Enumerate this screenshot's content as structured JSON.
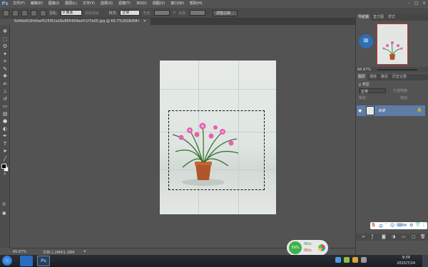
{
  "app": {
    "logo": "Ps",
    "menus": [
      "文件(F)",
      "编辑(E)",
      "图像(I)",
      "图层(L)",
      "文字(Y)",
      "选择(S)",
      "滤镜(T)",
      "3D(D)",
      "视图(V)",
      "窗口(W)",
      "帮助(H)"
    ],
    "window_controls": [
      "–",
      "□",
      "×"
    ]
  },
  "options_bar": {
    "feather_label": "羽化:",
    "feather_value": "0 像素",
    "antialias_label": "消除锯齿",
    "style_label": "样式:",
    "style_value": "正常",
    "width_label": "宽度:",
    "height_label": "高度:",
    "refine_button": "调整边缘..."
  },
  "document": {
    "tab_title": "6d4bb616fdfaef515f61a16e895494eef11f7a05.jpg @ 66.7%(RGB/8#)",
    "tab_close": "×"
  },
  "tools": [
    {
      "icon": "move-tool",
      "glyph": "✥"
    },
    {
      "icon": "marquee-tool",
      "glyph": "⬚"
    },
    {
      "icon": "lasso-tool",
      "glyph": "ʘ"
    },
    {
      "icon": "magic-wand-tool",
      "glyph": "✦"
    },
    {
      "icon": "crop-tool",
      "glyph": "⌗"
    },
    {
      "icon": "eyedropper-tool",
      "glyph": "✎"
    },
    {
      "icon": "healing-brush-tool",
      "glyph": "✚"
    },
    {
      "icon": "brush-tool",
      "glyph": "✍"
    },
    {
      "icon": "clone-stamp-tool",
      "glyph": "⊥"
    },
    {
      "icon": "history-brush-tool",
      "glyph": "↺"
    },
    {
      "icon": "eraser-tool",
      "glyph": "▭"
    },
    {
      "icon": "gradient-tool",
      "glyph": "▤"
    },
    {
      "icon": "blur-tool",
      "glyph": "●"
    },
    {
      "icon": "dodge-tool",
      "glyph": "◐"
    },
    {
      "icon": "pen-tool",
      "glyph": "✒"
    },
    {
      "icon": "type-tool",
      "glyph": "T"
    },
    {
      "icon": "path-selection-tool",
      "glyph": "➤"
    },
    {
      "icon": "shape-tool",
      "glyph": "╱"
    },
    {
      "icon": "hand-tool",
      "glyph": "✋"
    },
    {
      "icon": "zoom-tool",
      "glyph": "⌕"
    }
  ],
  "status_bar": {
    "zoom": "66.67%",
    "doc_info": "文档:1.28M/1.28M"
  },
  "float_widget": {
    "percent": "59%",
    "up_speed": "0K/s",
    "down_speed": "0K/s"
  },
  "navigator": {
    "tabs": [
      "导航器",
      "直方图",
      "样式"
    ],
    "zoom": "66.67%"
  },
  "layers_panel": {
    "tabs": [
      "图层",
      "通道",
      "路径",
      "历史记录"
    ],
    "kind_label": "ρ 类型",
    "blend_mode": "正常",
    "opacity_label": "不透明度:",
    "lock_label": "锁定:",
    "fill_label": "填充:",
    "layer_name": "背景"
  },
  "taskbar": {
    "time": "9:39",
    "date": "2015/7/24",
    "active_app": "Ps"
  },
  "ime_bar": {
    "glyphs": [
      "S",
      "中",
      "’",
      "☺",
      "⌨",
      "✉",
      "⚙",
      "👕",
      "⋮⋮"
    ]
  }
}
